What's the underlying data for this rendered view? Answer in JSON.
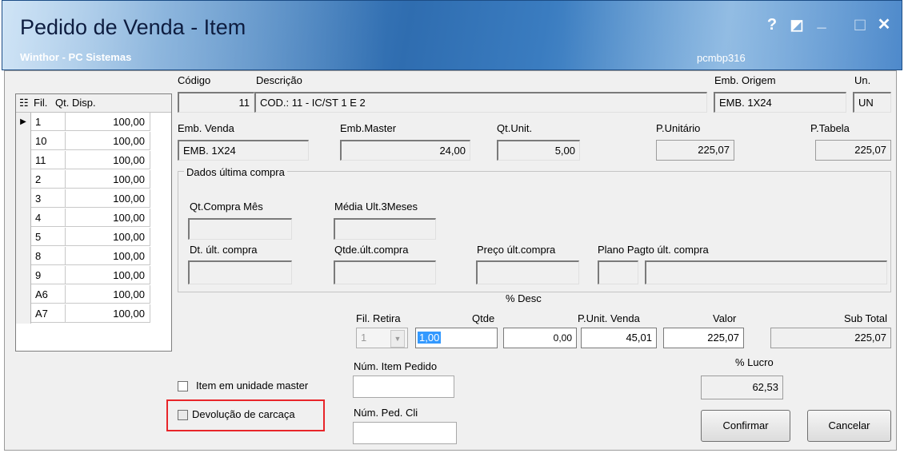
{
  "window": {
    "title": "Pedido de Venda - Item",
    "subtitle": "Winthor - PC Sistemas",
    "routine": "pcmbp316",
    "controls": {
      "help": "?",
      "restore": "◩",
      "minimize": "_",
      "maximize": "□",
      "close": "✕"
    }
  },
  "grid": {
    "headers": {
      "indicator": "☷",
      "fil": "Fil.",
      "qt": "Qt. Disp."
    },
    "rows": [
      {
        "fil": "1",
        "qt": "100,00"
      },
      {
        "fil": "10",
        "qt": "100,00"
      },
      {
        "fil": "11",
        "qt": "100,00"
      },
      {
        "fil": "2",
        "qt": "100,00"
      },
      {
        "fil": "3",
        "qt": "100,00"
      },
      {
        "fil": "4",
        "qt": "100,00"
      },
      {
        "fil": "5",
        "qt": "100,00"
      },
      {
        "fil": "8",
        "qt": "100,00"
      },
      {
        "fil": "9",
        "qt": "100,00"
      },
      {
        "fil": "A6",
        "qt": "100,00"
      },
      {
        "fil": "A7",
        "qt": "100,00"
      }
    ],
    "current_marker": "▶"
  },
  "fields": {
    "codigo": {
      "label": "Código",
      "value": "11"
    },
    "descricao": {
      "label": "Descrição",
      "value": "COD.: 11 - IC/ST 1 E 2"
    },
    "emb_origem": {
      "label": "Emb. Origem",
      "value": "EMB. 1X24"
    },
    "un": {
      "label": "Un.",
      "value": "UN"
    },
    "emb_venda": {
      "label": "Emb. Venda",
      "value": "EMB. 1X24"
    },
    "emb_master": {
      "label": "Emb.Master",
      "value": "24,00"
    },
    "qt_unit": {
      "label": "Qt.Unit.",
      "value": "5,00"
    },
    "p_unitario": {
      "label": "P.Unitário",
      "value": "225,07"
    },
    "p_tabela": {
      "label": "P.Tabela",
      "value": "225,07"
    }
  },
  "ultima_compra": {
    "group_label": "Dados última compra",
    "qt_compra_mes": "Qt.Compra Mês",
    "media_ult_3meses": "Média Ult.3Meses",
    "dt_ult_compra": "Dt. últ. compra",
    "qtde_ult_compra": "Qtde.últ.compra",
    "preco_ult_compra": "Preço últ.compra",
    "plano_pagto": "Plano Pagto últ. compra"
  },
  "venda": {
    "desc_label": "% Desc",
    "fil_retira": {
      "label": "Fil. Retira",
      "value": "1"
    },
    "qtde": {
      "label": "Qtde",
      "value": "1,00"
    },
    "desc_value": "0,00",
    "p_unit_venda": {
      "label": "P.Unit. Venda",
      "value": "45,01"
    },
    "valor": {
      "label": "Valor",
      "value": "225,07"
    },
    "sub_total": {
      "label": "Sub Total",
      "value": "225,07"
    },
    "num_item_pedido": {
      "label": "Núm. Item Pedido",
      "value": ""
    },
    "num_ped_cli": {
      "label": "Núm. Ped. Cli",
      "value": ""
    },
    "lucro": {
      "label": "% Lucro",
      "value": "62,53"
    }
  },
  "options": {
    "item_unidade_master": "Item em unidade master",
    "devolucao_carcaca": "Devolução de carcaça"
  },
  "buttons": {
    "confirmar": "Confirmar",
    "cancelar": "Cancelar"
  }
}
